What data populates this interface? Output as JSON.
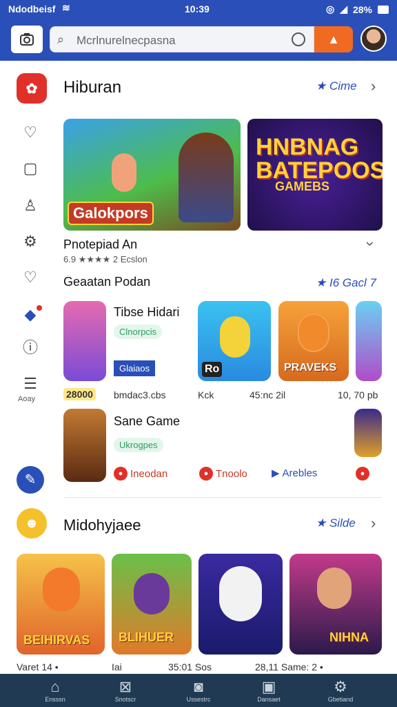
{
  "status_bar": {
    "carrier": "Ndodbeisf",
    "time": "10:39",
    "battery": "28%"
  },
  "top_bar": {
    "search_placeholder": "Mcrlnurelnecpasna"
  },
  "section1": {
    "title": "Hiburan",
    "more_label": "Cime",
    "banner1_label": "Galokpors",
    "banner2_title": "HNBNAG BATEPOOS",
    "banner2_sub": "GAMEBS",
    "app_title": "Pnotepiad An",
    "app_meta": "6.9 ★★★★ 2 Ecslon"
  },
  "section2": {
    "title": "Geaatan Podan",
    "more_label": "I6 Gacl 7",
    "app1_name": "Tibse Hidari",
    "app1_chip": "Clnorpcis",
    "app1_btn": "Glaiaos",
    "app1_price": "28000",
    "app1_sub": "bmdac3.cbs",
    "tile2_label": "Ro",
    "tile2_caption": "Kck",
    "tile3_label": "PRAVEKS",
    "tile3_caption": "45:nc 2il",
    "tile4_caption": "10, 70 pb",
    "app2_name": "Sane Game",
    "app2_chip": "Ukrogpes",
    "rtags": [
      "Ineodan",
      "Tnoolo",
      "Arebles"
    ]
  },
  "section3": {
    "title": "Midohyjaee",
    "more_label": "Silde",
    "tiles": [
      {
        "label": "BEIHIRVAS",
        "caption": "Varet 14 •"
      },
      {
        "label": "BLIHUER",
        "caption": "Iai"
      },
      {
        "label": "",
        "caption": "35:01 Sos"
      },
      {
        "label": "NIHNA",
        "caption": "28,11 Same: 2 •"
      }
    ]
  },
  "rail": {
    "bottom_label": "Aoay"
  },
  "bottom_nav": [
    {
      "label": "Ensssn",
      "icon": "home-icon"
    },
    {
      "label": "Snotscr",
      "icon": "store-icon"
    },
    {
      "label": "Ussestrc",
      "icon": "camera-icon"
    },
    {
      "label": "Dansaet",
      "icon": "square-icon"
    },
    {
      "label": "Gbetiand",
      "icon": "gear-icon"
    }
  ],
  "colors": {
    "brand_blue": "#2a4fb8",
    "accent_orange": "#f06a22",
    "nav_bg": "#1f3a52"
  }
}
